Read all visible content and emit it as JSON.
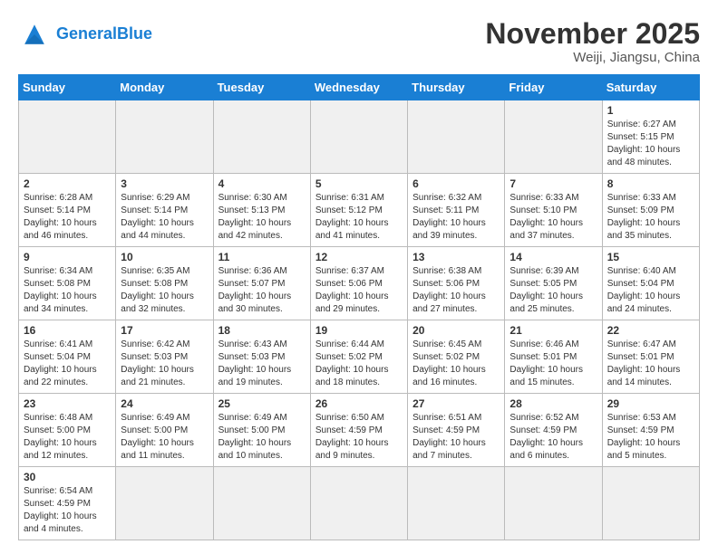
{
  "header": {
    "logo_general": "General",
    "logo_blue": "Blue",
    "title": "November 2025",
    "location": "Weiji, Jiangsu, China"
  },
  "days_of_week": [
    "Sunday",
    "Monday",
    "Tuesday",
    "Wednesday",
    "Thursday",
    "Friday",
    "Saturday"
  ],
  "weeks": [
    [
      {
        "num": "",
        "info": ""
      },
      {
        "num": "",
        "info": ""
      },
      {
        "num": "",
        "info": ""
      },
      {
        "num": "",
        "info": ""
      },
      {
        "num": "",
        "info": ""
      },
      {
        "num": "",
        "info": ""
      },
      {
        "num": "1",
        "info": "Sunrise: 6:27 AM\nSunset: 5:15 PM\nDaylight: 10 hours and 48 minutes."
      }
    ],
    [
      {
        "num": "2",
        "info": "Sunrise: 6:28 AM\nSunset: 5:14 PM\nDaylight: 10 hours and 46 minutes."
      },
      {
        "num": "3",
        "info": "Sunrise: 6:29 AM\nSunset: 5:14 PM\nDaylight: 10 hours and 44 minutes."
      },
      {
        "num": "4",
        "info": "Sunrise: 6:30 AM\nSunset: 5:13 PM\nDaylight: 10 hours and 42 minutes."
      },
      {
        "num": "5",
        "info": "Sunrise: 6:31 AM\nSunset: 5:12 PM\nDaylight: 10 hours and 41 minutes."
      },
      {
        "num": "6",
        "info": "Sunrise: 6:32 AM\nSunset: 5:11 PM\nDaylight: 10 hours and 39 minutes."
      },
      {
        "num": "7",
        "info": "Sunrise: 6:33 AM\nSunset: 5:10 PM\nDaylight: 10 hours and 37 minutes."
      },
      {
        "num": "8",
        "info": "Sunrise: 6:33 AM\nSunset: 5:09 PM\nDaylight: 10 hours and 35 minutes."
      }
    ],
    [
      {
        "num": "9",
        "info": "Sunrise: 6:34 AM\nSunset: 5:08 PM\nDaylight: 10 hours and 34 minutes."
      },
      {
        "num": "10",
        "info": "Sunrise: 6:35 AM\nSunset: 5:08 PM\nDaylight: 10 hours and 32 minutes."
      },
      {
        "num": "11",
        "info": "Sunrise: 6:36 AM\nSunset: 5:07 PM\nDaylight: 10 hours and 30 minutes."
      },
      {
        "num": "12",
        "info": "Sunrise: 6:37 AM\nSunset: 5:06 PM\nDaylight: 10 hours and 29 minutes."
      },
      {
        "num": "13",
        "info": "Sunrise: 6:38 AM\nSunset: 5:06 PM\nDaylight: 10 hours and 27 minutes."
      },
      {
        "num": "14",
        "info": "Sunrise: 6:39 AM\nSunset: 5:05 PM\nDaylight: 10 hours and 25 minutes."
      },
      {
        "num": "15",
        "info": "Sunrise: 6:40 AM\nSunset: 5:04 PM\nDaylight: 10 hours and 24 minutes."
      }
    ],
    [
      {
        "num": "16",
        "info": "Sunrise: 6:41 AM\nSunset: 5:04 PM\nDaylight: 10 hours and 22 minutes."
      },
      {
        "num": "17",
        "info": "Sunrise: 6:42 AM\nSunset: 5:03 PM\nDaylight: 10 hours and 21 minutes."
      },
      {
        "num": "18",
        "info": "Sunrise: 6:43 AM\nSunset: 5:03 PM\nDaylight: 10 hours and 19 minutes."
      },
      {
        "num": "19",
        "info": "Sunrise: 6:44 AM\nSunset: 5:02 PM\nDaylight: 10 hours and 18 minutes."
      },
      {
        "num": "20",
        "info": "Sunrise: 6:45 AM\nSunset: 5:02 PM\nDaylight: 10 hours and 16 minutes."
      },
      {
        "num": "21",
        "info": "Sunrise: 6:46 AM\nSunset: 5:01 PM\nDaylight: 10 hours and 15 minutes."
      },
      {
        "num": "22",
        "info": "Sunrise: 6:47 AM\nSunset: 5:01 PM\nDaylight: 10 hours and 14 minutes."
      }
    ],
    [
      {
        "num": "23",
        "info": "Sunrise: 6:48 AM\nSunset: 5:00 PM\nDaylight: 10 hours and 12 minutes."
      },
      {
        "num": "24",
        "info": "Sunrise: 6:49 AM\nSunset: 5:00 PM\nDaylight: 10 hours and 11 minutes."
      },
      {
        "num": "25",
        "info": "Sunrise: 6:49 AM\nSunset: 5:00 PM\nDaylight: 10 hours and 10 minutes."
      },
      {
        "num": "26",
        "info": "Sunrise: 6:50 AM\nSunset: 4:59 PM\nDaylight: 10 hours and 9 minutes."
      },
      {
        "num": "27",
        "info": "Sunrise: 6:51 AM\nSunset: 4:59 PM\nDaylight: 10 hours and 7 minutes."
      },
      {
        "num": "28",
        "info": "Sunrise: 6:52 AM\nSunset: 4:59 PM\nDaylight: 10 hours and 6 minutes."
      },
      {
        "num": "29",
        "info": "Sunrise: 6:53 AM\nSunset: 4:59 PM\nDaylight: 10 hours and 5 minutes."
      }
    ],
    [
      {
        "num": "30",
        "info": "Sunrise: 6:54 AM\nSunset: 4:59 PM\nDaylight: 10 hours and 4 minutes."
      },
      {
        "num": "",
        "info": ""
      },
      {
        "num": "",
        "info": ""
      },
      {
        "num": "",
        "info": ""
      },
      {
        "num": "",
        "info": ""
      },
      {
        "num": "",
        "info": ""
      },
      {
        "num": "",
        "info": ""
      }
    ]
  ]
}
